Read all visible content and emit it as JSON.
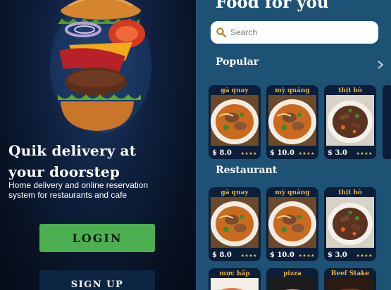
{
  "onboarding": {
    "headline_line1": "Quik delivery  at",
    "headline_line2": "your doorstep",
    "subtext": "Home delivery and online reservation system for restaurants and cafe",
    "login_label": "LOGIN",
    "signup_label": "SIGN UP"
  },
  "home": {
    "title": "Food for you",
    "search_placeholder": "Search",
    "popular_title": "Popular",
    "restaurant_title": "Restaurant",
    "popular": [
      {
        "name": "gà quay",
        "price": "$ 8.0",
        "rating": "★★★★",
        "dish": "soup"
      },
      {
        "name": "mỳ quảng",
        "price": "$ 10.0",
        "rating": "★★★★",
        "dish": "soup"
      },
      {
        "name": "thịt bò",
        "price": "$ 3.0",
        "rating": "★★★★",
        "dish": "beef"
      }
    ],
    "restaurant": [
      {
        "name": "gà quay",
        "price": "$ 8.0",
        "rating": "★★★★",
        "dish": "soup"
      },
      {
        "name": "mỳ quảng",
        "price": "$ 10.0",
        "rating": "★★★★",
        "dish": "soup"
      },
      {
        "name": "thịt bò",
        "price": "$ 3.0",
        "rating": "★★★★",
        "dish": "beef"
      }
    ],
    "third_row": [
      {
        "name": "mực hấp"
      },
      {
        "name": "pizza"
      },
      {
        "name": "Beef Stake"
      }
    ]
  },
  "colors": {
    "login_green": "#4caf50",
    "panel_blue": "#1e5275",
    "card_navy": "#0b1e3a",
    "label_gold": "#e8b23a"
  },
  "icons": {
    "search": "search-icon",
    "chevron": "chevron-right-icon"
  }
}
